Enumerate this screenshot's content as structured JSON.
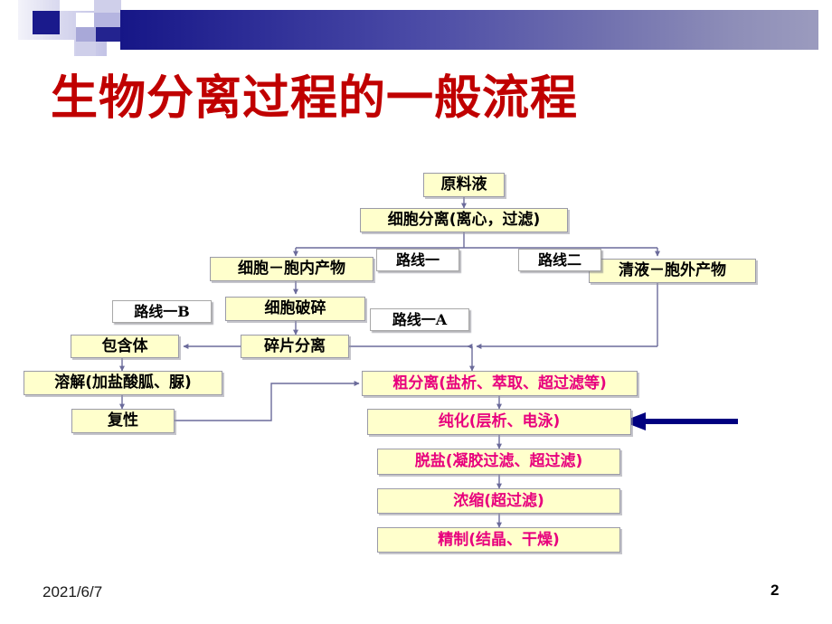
{
  "slide": {
    "title": "生物分离过程的一般流程",
    "title_color": "#C00000",
    "date": "2021/6/7",
    "page_number": "2",
    "box_fill": "#FFFFCC",
    "red_text_color": "#E8007D",
    "highlight_arrow_color": "#000080"
  },
  "flow": {
    "boxes": [
      {
        "id": "feed",
        "text": "原料液"
      },
      {
        "id": "cellsep",
        "text": "细胞分离(离心，过滤)"
      },
      {
        "id": "cell_intra",
        "text": "细胞－胞内产物"
      },
      {
        "id": "clear_extra",
        "text": "清液－胞外产物"
      },
      {
        "id": "disrupt",
        "text": "细胞破碎"
      },
      {
        "id": "inclusion",
        "text": "包含体"
      },
      {
        "id": "debris",
        "text": "碎片分离"
      },
      {
        "id": "dissolve",
        "text": "溶解(加盐酸胍、脲)"
      },
      {
        "id": "refold",
        "text": "复性"
      },
      {
        "id": "coarse",
        "text": "粗分离(盐析、萃取、超过滤等)"
      },
      {
        "id": "purify",
        "text": "纯化(层析、电泳)"
      },
      {
        "id": "desalt",
        "text": "脱盐(凝胶过滤、超过滤)"
      },
      {
        "id": "concentrate",
        "text": "浓缩(超过滤)"
      },
      {
        "id": "finish",
        "text": "精制(结晶、干燥)"
      }
    ],
    "route_labels": [
      {
        "id": "route1",
        "text": "路线一"
      },
      {
        "id": "route2",
        "text": "路线二"
      },
      {
        "id": "route1b",
        "text": "路线一B"
      },
      {
        "id": "route1a",
        "text": "路线一A"
      }
    ]
  }
}
